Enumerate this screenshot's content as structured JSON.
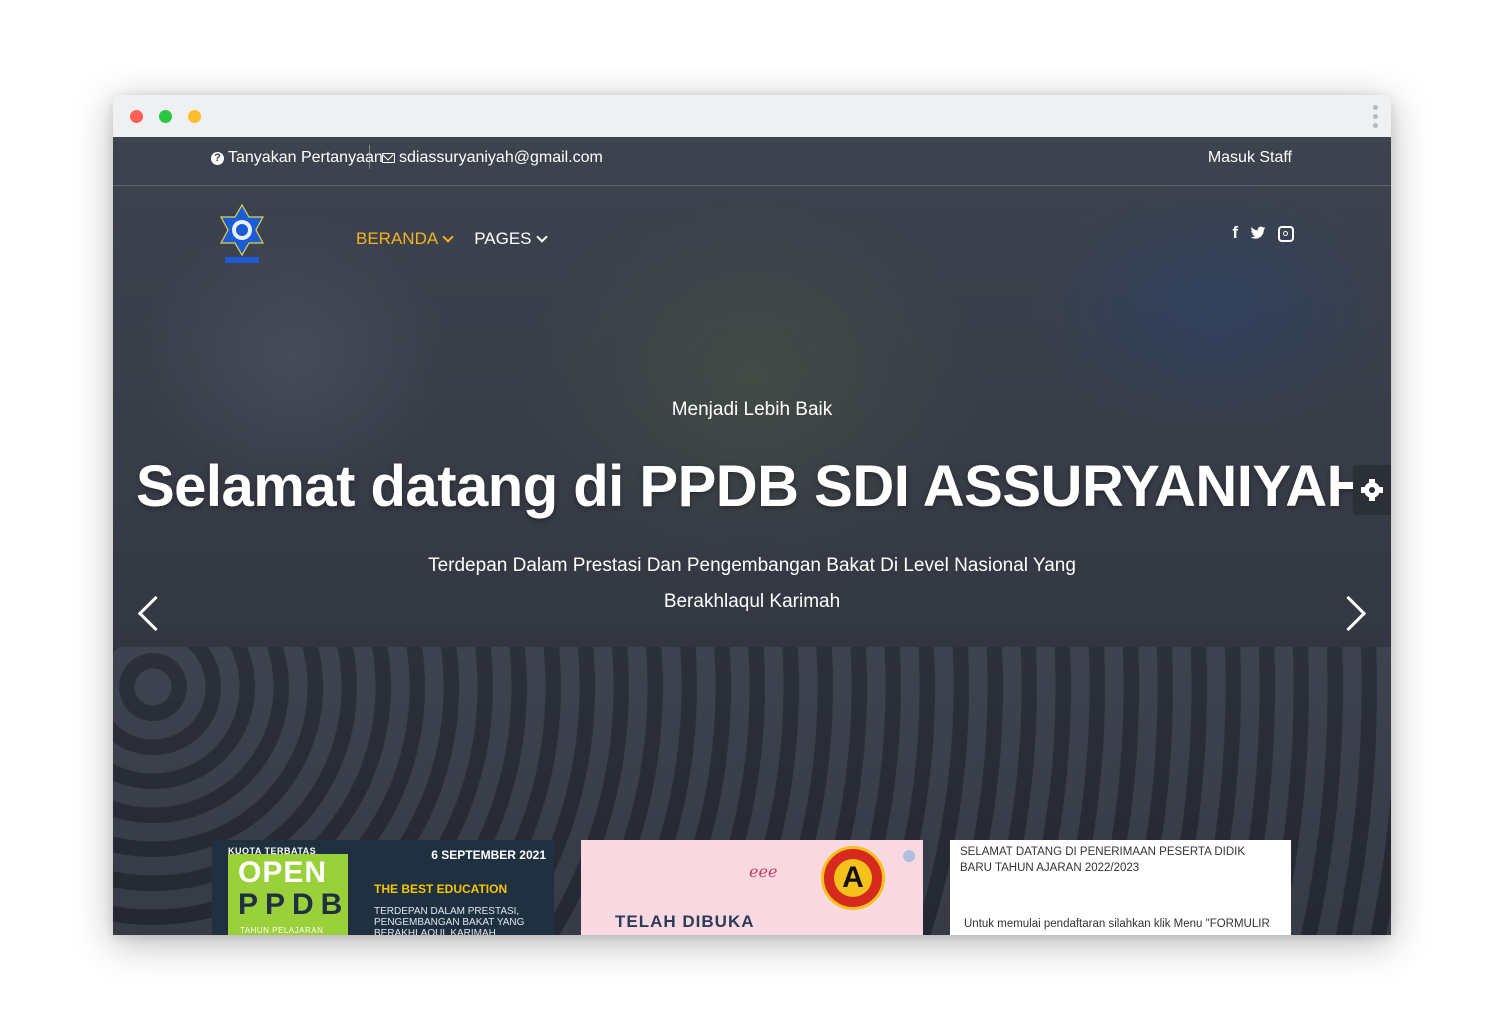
{
  "topbar": {
    "question_label": "Tanyakan Pertanyaan",
    "email": "sdiassuryaniyah@gmail.com",
    "staff_login": "Masuk Staff"
  },
  "nav": {
    "items": [
      {
        "label": "BERANDA",
        "active": true
      },
      {
        "label": "PAGES",
        "active": false
      }
    ],
    "active_color": "#f6b21a"
  },
  "social": {
    "facebook": "f",
    "twitter": "🐦"
  },
  "hero": {
    "eyebrow": "Menjadi Lebih Baik",
    "headline": "Selamat datang di PPDB SDI ASSURYANIYAH",
    "description": "Terdepan Dalam Prestasi Dan Pengembangan Bakat Di Level Nasional Yang Berakhlaqul Karimah"
  },
  "cards": {
    "one": {
      "tag": "KUOTA TERBATAS",
      "open": "OPEN",
      "ppdb": "PPDB",
      "year": "TAHUN PELAJARAN",
      "date": "6 SEPTEMBER 2021",
      "best": "THE BEST EDUCATION",
      "sub": "TERDEPAN DALAM PRESTASI, PENGEMBANGAN BAKAT YANG BERAKHLAQUL KARIMAH"
    },
    "two": {
      "title": "TELAH DIBUKA",
      "badge": "A"
    },
    "three": {
      "heading": "SELAMAT DATANG DI PENERIMAAN PESERTA DIDIK BARU TAHUN AJARAN 2022/2023",
      "body": "Untuk memulai pendaftaran silahkan klik Menu \"FORMULIR"
    }
  },
  "colors": {
    "accent": "#f6b21a",
    "traffic_red": "#ff5f57",
    "traffic_green": "#2ac840",
    "traffic_yellow": "#ffbd2e"
  }
}
